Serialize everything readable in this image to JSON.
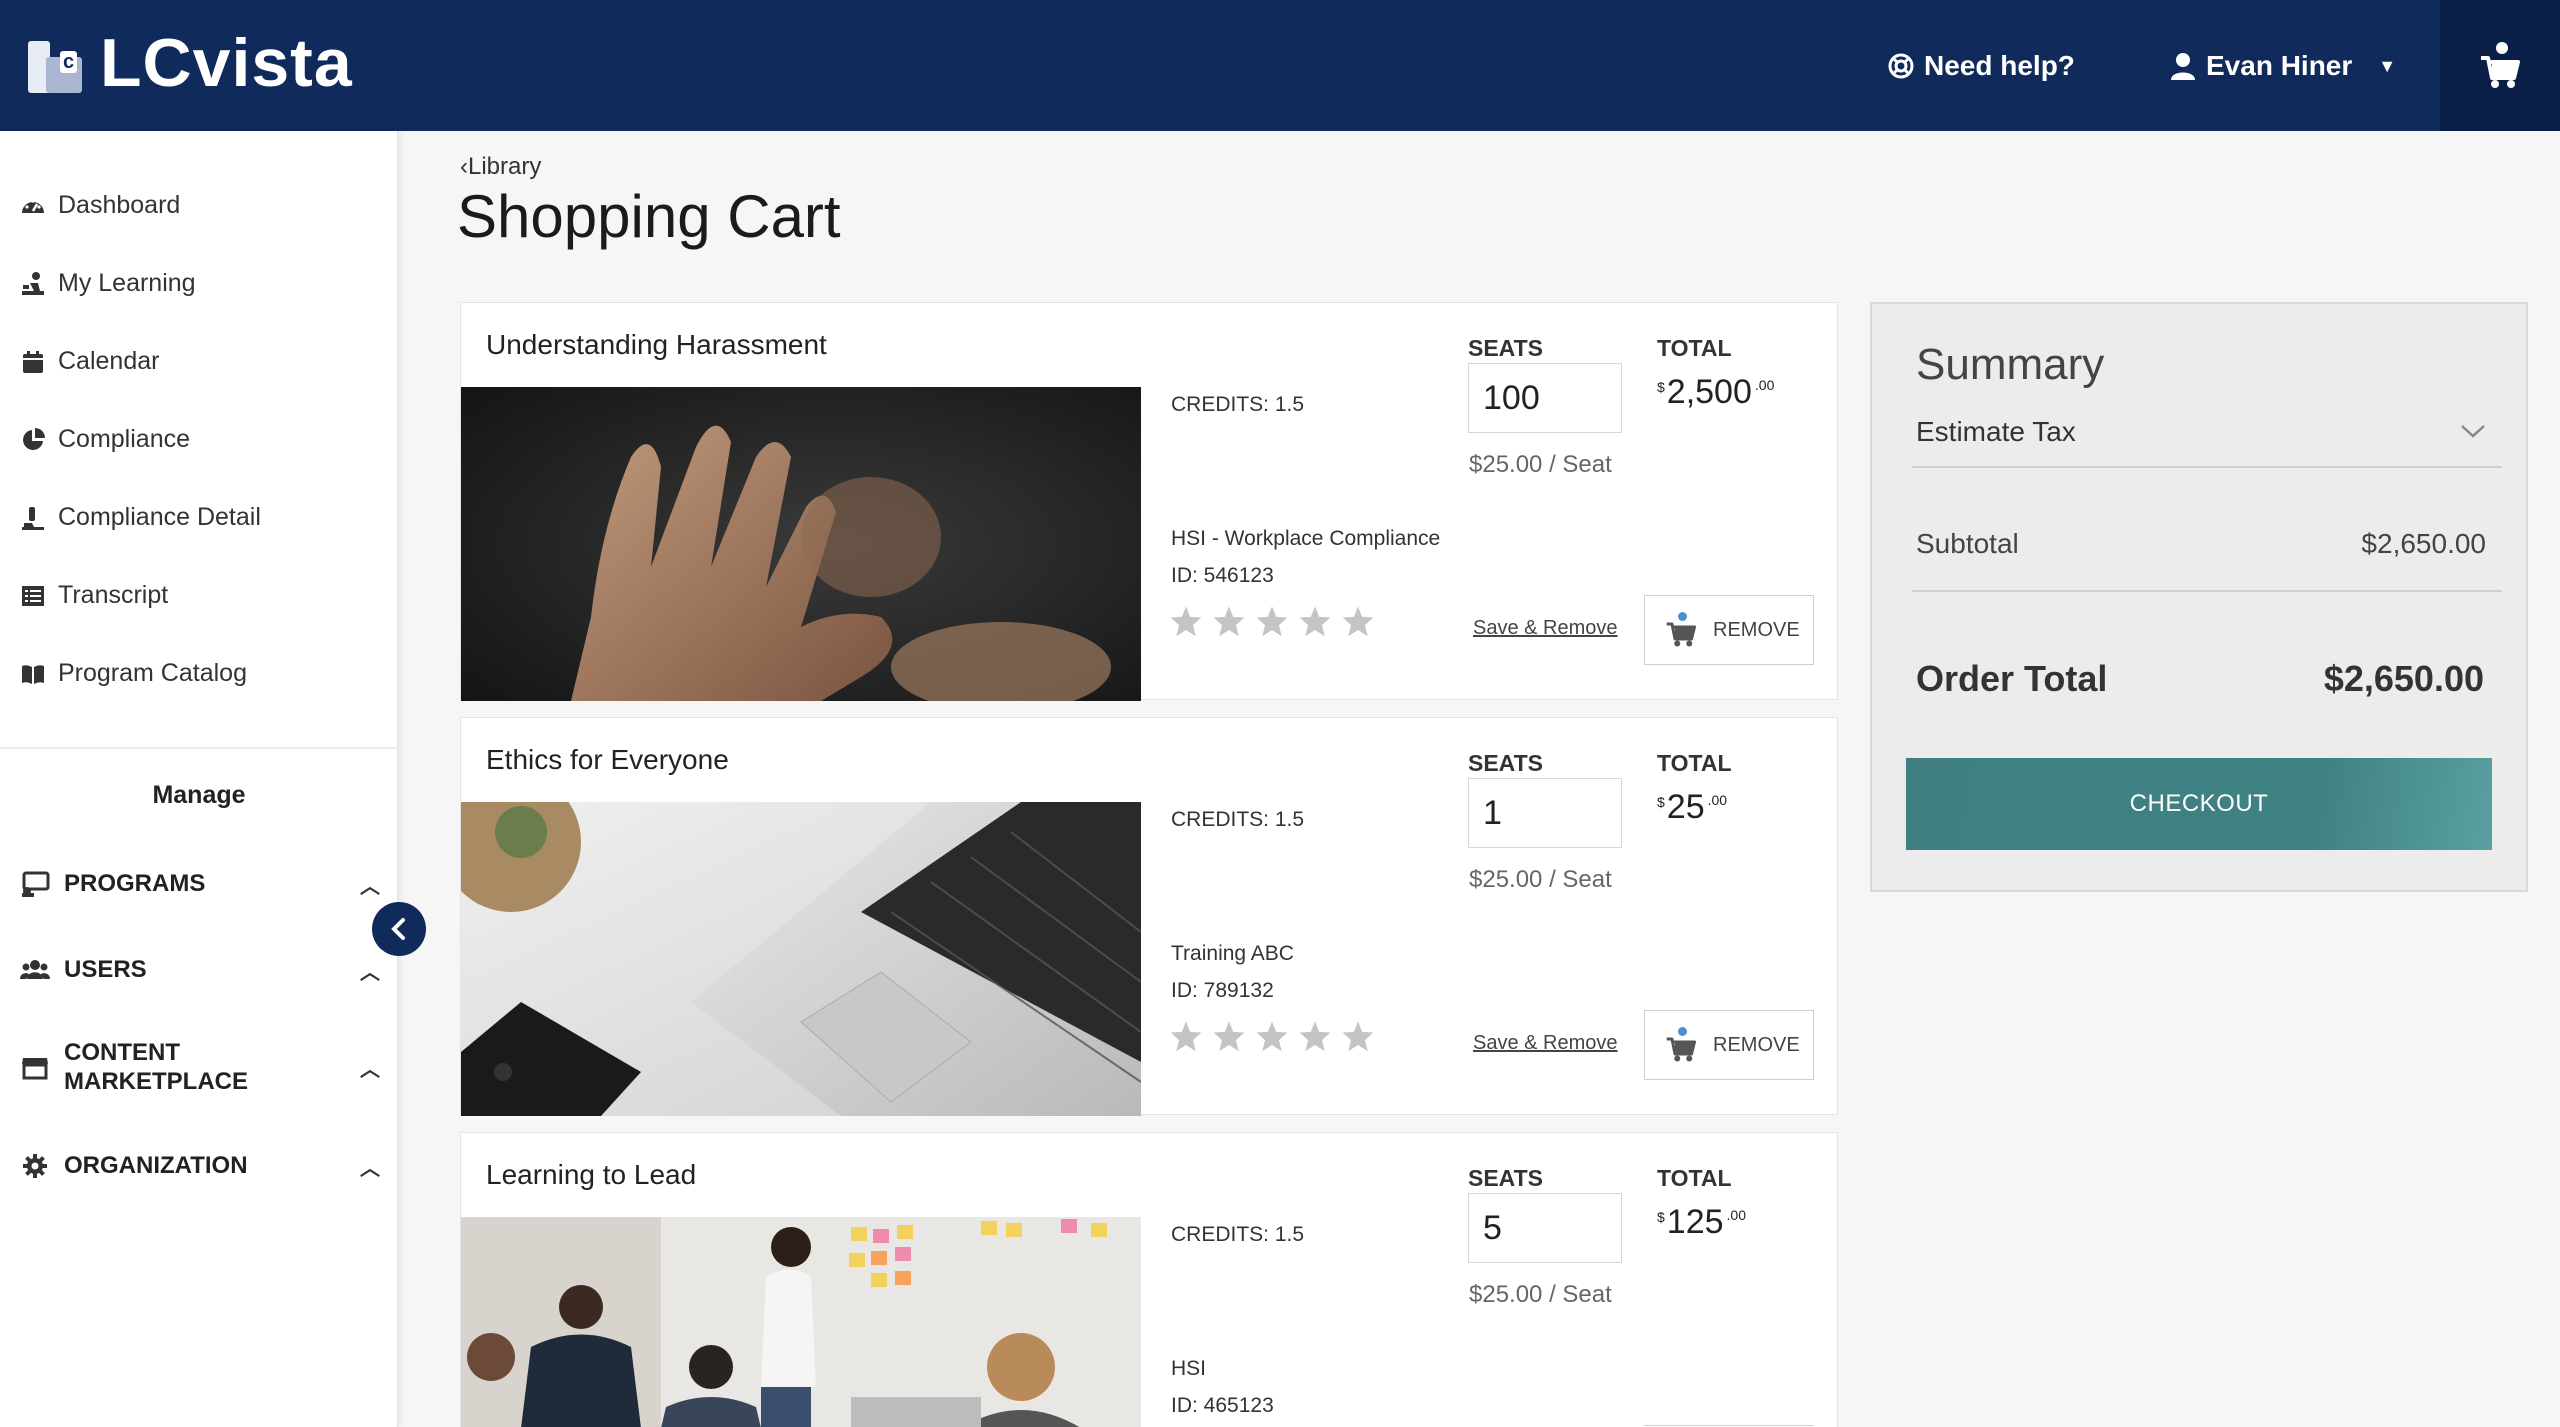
{
  "header": {
    "logo_text": "LCvista",
    "logo_badge": "c",
    "help_label": "Need help?",
    "user_name": "Evan Hiner",
    "brand_color": "#102a5c"
  },
  "sidebar": {
    "items": [
      {
        "label": "Dashboard",
        "icon": "dashboard-icon"
      },
      {
        "label": "My Learning",
        "icon": "learning-icon"
      },
      {
        "label": "Calendar",
        "icon": "calendar-icon"
      },
      {
        "label": "Compliance",
        "icon": "pie-chart-icon"
      },
      {
        "label": "Compliance Detail",
        "icon": "compliance-detail-icon"
      },
      {
        "label": "Transcript",
        "icon": "list-icon"
      },
      {
        "label": "Program Catalog",
        "icon": "book-icon"
      }
    ],
    "manage_title": "Manage",
    "sections": [
      {
        "label": "PROGRAMS",
        "icon": "programs-icon"
      },
      {
        "label": "USERS",
        "icon": "users-icon"
      },
      {
        "label": "CONTENT",
        "label2": "MARKETPLACE",
        "icon": "store-icon"
      },
      {
        "label": "ORGANIZATION",
        "icon": "gear-icon"
      }
    ]
  },
  "page": {
    "back_label": "Library",
    "title": "Shopping Cart"
  },
  "cart": {
    "seats_label": "SEATS",
    "total_label": "TOTAL",
    "save_remove_label": "Save & Remove",
    "remove_label": "REMOVE",
    "items": [
      {
        "title": "Understanding Harassment",
        "credits": "CREDITS: 1.5",
        "provider": "HSI - Workplace Compliance",
        "id": "ID: 546123",
        "seats": "100",
        "per_seat": "$25.00 / Seat",
        "total_symbol": "$",
        "total_amount": "2,500",
        "total_cents": ".00",
        "rating": 0
      },
      {
        "title": "Ethics for Everyone",
        "credits": "CREDITS: 1.5",
        "provider": "Training ABC",
        "id": "ID: 789132",
        "seats": "1",
        "per_seat": "$25.00 / Seat",
        "total_symbol": "$",
        "total_amount": "25",
        "total_cents": ".00",
        "rating": 0
      },
      {
        "title": "Learning to Lead",
        "credits": "CREDITS: 1.5",
        "provider": "HSI",
        "id": "ID: 465123",
        "seats": "5",
        "per_seat": "$25.00 / Seat",
        "total_symbol": "$",
        "total_amount": "125",
        "total_cents": ".00",
        "rating": 0
      }
    ]
  },
  "summary": {
    "title": "Summary",
    "estimate_tax_label": "Estimate Tax",
    "subtotal_label": "Subtotal",
    "subtotal_value": "$2,650.00",
    "order_total_label": "Order Total",
    "order_total_value": "$2,650.00",
    "checkout_label": "CHECKOUT",
    "checkout_color": "#3f8283"
  }
}
